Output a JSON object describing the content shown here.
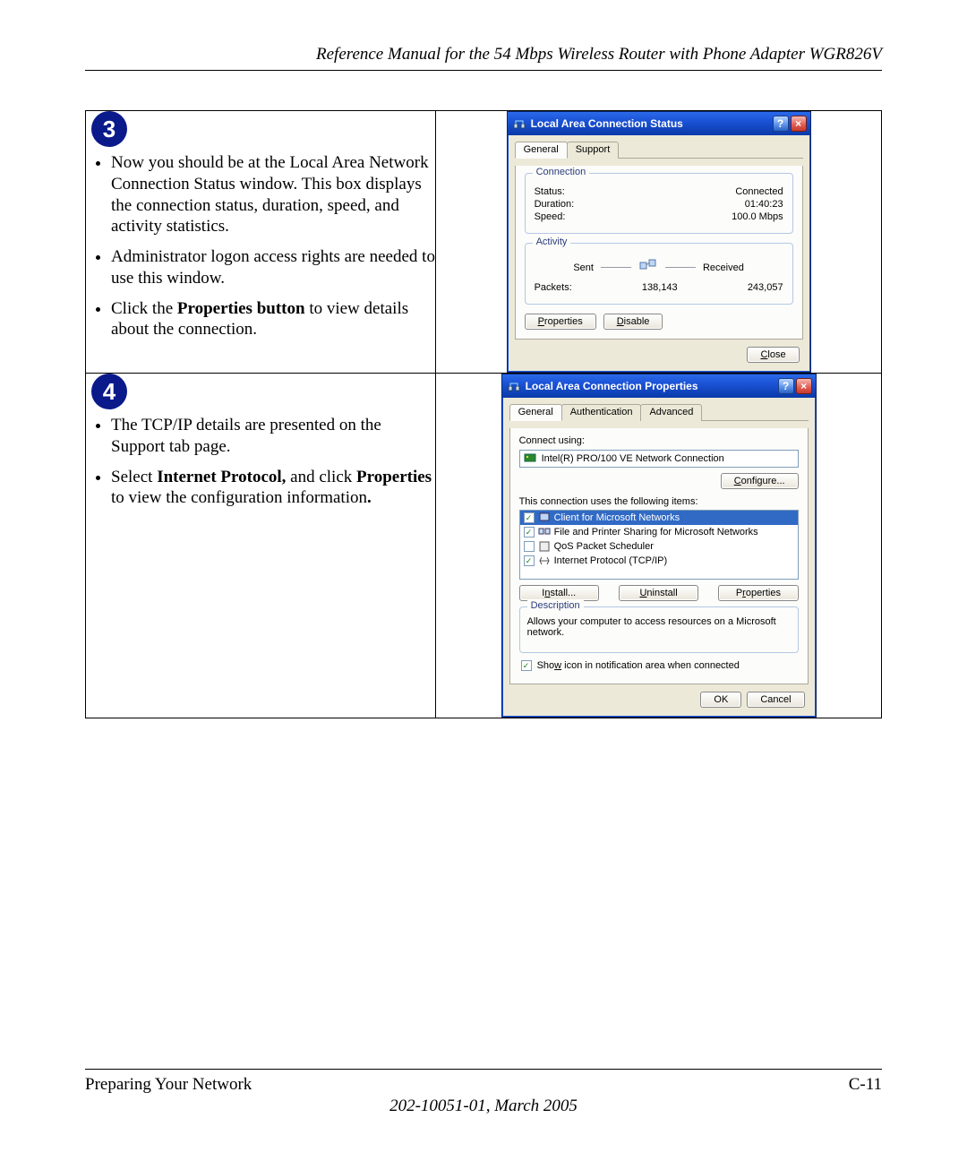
{
  "header": {
    "title": "Reference Manual for the 54 Mbps Wireless Router with Phone Adapter WGR826V"
  },
  "steps": {
    "s3": {
      "num": "3",
      "b1": "Now you should be at the Local Area Network Connection Status window. This box displays the connection status, duration, speed, and activity statistics.",
      "b2": "Administrator logon access rights are needed to use this window.",
      "b3_pre": "Click the ",
      "b3_bold": "Properties button",
      "b3_post": " to view details about the connection."
    },
    "s4": {
      "num": "4",
      "b1": "The TCP/IP details are presented on the Support tab page.",
      "b2_pre": "Select ",
      "b2_bold1": "Internet Protocol,",
      "b2_mid": " and click ",
      "b2_bold2": "Properties",
      "b2_post": " to view the configuration information",
      "b2_dot": "."
    }
  },
  "status_win": {
    "title": "Local Area Connection Status",
    "tabs": {
      "general": "General",
      "support": "Support"
    },
    "connection": {
      "legend": "Connection",
      "status_lbl": "Status:",
      "status_val": "Connected",
      "duration_lbl": "Duration:",
      "duration_val": "01:40:23",
      "speed_lbl": "Speed:",
      "speed_val": "100.0 Mbps"
    },
    "activity": {
      "legend": "Activity",
      "sent": "Sent",
      "received": "Received",
      "packets_lbl": "Packets:",
      "sent_val": "138,143",
      "recv_val": "243,057"
    },
    "buttons": {
      "properties": "Properties",
      "disable": "Disable",
      "close": "Close"
    }
  },
  "props_win": {
    "title": "Local Area Connection Properties",
    "tabs": {
      "general": "General",
      "auth": "Authentication",
      "adv": "Advanced"
    },
    "connect_using_lbl": "Connect using:",
    "adapter": "Intel(R) PRO/100 VE Network Connection",
    "configure": "Configure...",
    "items_lbl": "This connection uses the following items:",
    "items": [
      {
        "checked": true,
        "label": "Client for Microsoft Networks",
        "selected": true
      },
      {
        "checked": true,
        "label": "File and Printer Sharing for Microsoft Networks",
        "selected": false
      },
      {
        "checked": false,
        "label": "QoS Packet Scheduler",
        "selected": false
      },
      {
        "checked": true,
        "label": "Internet Protocol (TCP/IP)",
        "selected": false
      }
    ],
    "btn_install": "Install...",
    "btn_uninstall": "Uninstall",
    "btn_props": "Properties",
    "desc_legend": "Description",
    "desc_text": "Allows your computer to access resources on a Microsoft network.",
    "show_icon": "Show icon in notification area when connected",
    "ok": "OK",
    "cancel": "Cancel"
  },
  "footer": {
    "left": "Preparing Your Network",
    "right": "C-11",
    "center": "202-10051-01, March 2005"
  }
}
